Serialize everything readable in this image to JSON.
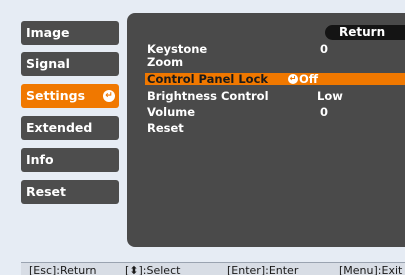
{
  "sidebar": {
    "items": [
      {
        "label": "Image"
      },
      {
        "label": "Signal"
      },
      {
        "label": "Settings"
      },
      {
        "label": "Extended"
      },
      {
        "label": "Info"
      },
      {
        "label": "Reset"
      }
    ],
    "active_index": 2
  },
  "panel": {
    "return_label": "Return",
    "rows": [
      {
        "label": "Keystone",
        "value": "0"
      },
      {
        "label": "Zoom",
        "value": ""
      },
      {
        "label": "Control Panel Lock",
        "value": "Off"
      },
      {
        "label": "Brightness Control",
        "value": "Low"
      },
      {
        "label": "Volume",
        "value": "0"
      },
      {
        "label": "Reset",
        "value": ""
      }
    ],
    "selected_index": 2
  },
  "status_bar": {
    "esc_hint": "[Esc]:Return",
    "select_hint": "[⬍]:Select",
    "enter_hint": "[Enter]:Enter",
    "menu_hint": "[Menu]:Exit"
  },
  "colors": {
    "accent": "#f07800",
    "panel_bg": "#4a4a4a",
    "sidebar_bg": "#4d4d4d",
    "screen_bg": "#e6ecf4"
  }
}
